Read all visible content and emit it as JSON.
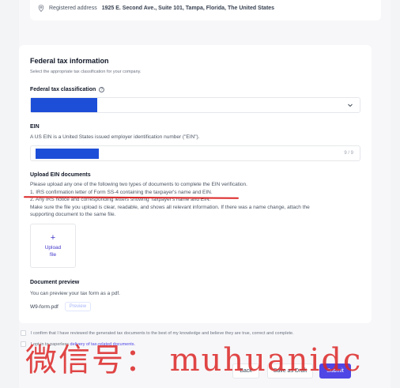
{
  "address": {
    "prefix": "Registered address",
    "value": "1925 E. Second Ave., Suite 101, Tampa, Florida, The United States"
  },
  "federal_tax": {
    "title": "Federal tax information",
    "subtitle": "Select the appropriate tax classification for your company.",
    "classification_label": "Federal tax classification",
    "help_icon_glyph": "?"
  },
  "ein": {
    "label": "EIN",
    "description": "A US EIN is a United States issued employer identification number (\"EIN\").",
    "counter": "9 / 9"
  },
  "upload": {
    "title": "Upload EIN documents",
    "line1": "Please upload any one of the following two types of documents to complete the EIN verification.",
    "line2": "1. IRS confirmation letter of Form SS-4 containing the taxpayer's name and EIN.",
    "line3": "2. Any IRS notice and corresponding letters showing Taxpayer's name and EIN.",
    "line4": "Make sure the file you upload is clear, readable, and shows all relevant information. If there was a name change, attach the",
    "line5": "supporting document to the same file.",
    "box_plus": "+",
    "box_label1": "Upload",
    "box_label2": "file"
  },
  "preview": {
    "title": "Document preview",
    "description": "You can preview your tax form as a pdf.",
    "filename": "W9-form.pdf",
    "button": "Preview"
  },
  "consent": {
    "confirm": "I confirm that I have reviewed the generated tax documents to the best of my knowledge and believe they are true, correct and complete.",
    "paperless_prefix": "I opt in to paperless",
    "paperless_link": "delivery of tax-related documents."
  },
  "actions": {
    "back": "Back",
    "draft": "Save as Draft",
    "submit": "Submit"
  },
  "watermark": "微信号： muhuanidc",
  "colors": {
    "accent": "#4f46e5",
    "redaction": "#1d4ed8",
    "annotation": "#dc2626"
  }
}
